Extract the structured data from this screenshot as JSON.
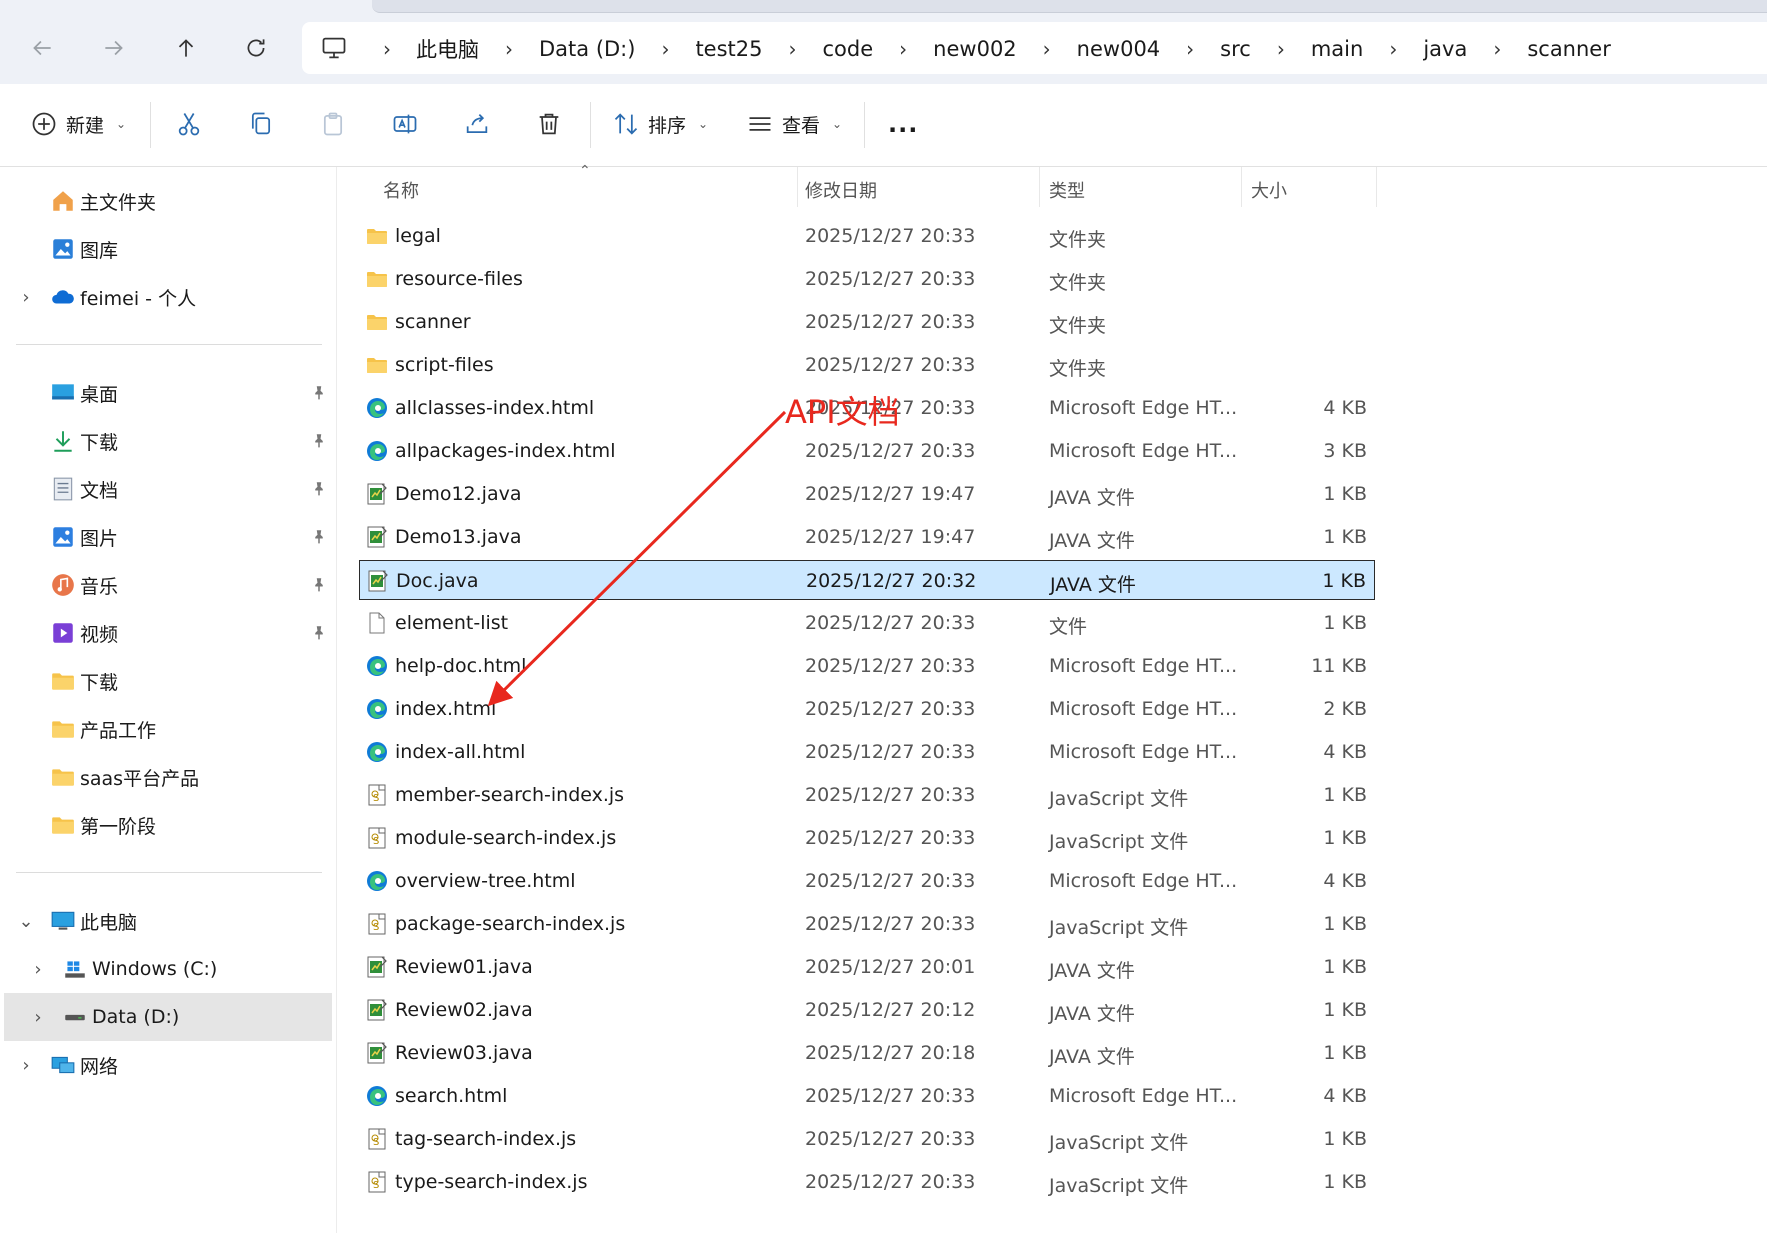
{
  "breadcrumb": [
    "此电脑",
    "Data (D:)",
    "test25",
    "code",
    "new002",
    "new004",
    "src",
    "main",
    "java",
    "scanner"
  ],
  "toolbar": {
    "new_label": "新建",
    "sort_label": "排序",
    "view_label": "查看",
    "more_label": "..."
  },
  "sidebar": {
    "quick": [
      {
        "label": "主文件夹",
        "icon": "home-icon"
      },
      {
        "label": "图库",
        "icon": "gallery-icon"
      },
      {
        "label": "feimei - 个人",
        "icon": "onedrive-cloud-icon"
      }
    ],
    "pinned": [
      {
        "label": "桌面",
        "icon": "desktop-icon",
        "pinned": true
      },
      {
        "label": "下载",
        "icon": "download-icon",
        "pinned": true
      },
      {
        "label": "文档",
        "icon": "document-icon",
        "pinned": true
      },
      {
        "label": "图片",
        "icon": "pictures-icon",
        "pinned": true
      },
      {
        "label": "音乐",
        "icon": "music-icon",
        "pinned": true
      },
      {
        "label": "视频",
        "icon": "video-icon",
        "pinned": true
      },
      {
        "label": "下载",
        "icon": "folder-icon",
        "pinned": false
      },
      {
        "label": "产品工作",
        "icon": "folder-icon",
        "pinned": false
      },
      {
        "label": "saas平台产品",
        "icon": "folder-icon",
        "pinned": false
      },
      {
        "label": "第一阶段",
        "icon": "folder-icon",
        "pinned": false
      }
    ],
    "this_pc": {
      "label": "此电脑",
      "icon": "computer-icon"
    },
    "drives": [
      {
        "label": "Windows (C:)",
        "icon": "windows-drive-icon"
      },
      {
        "label": "Data (D:)",
        "icon": "drive-icon",
        "selected": true
      }
    ],
    "network": {
      "label": "网络",
      "icon": "network-icon"
    }
  },
  "columns": {
    "name": "名称",
    "date": "修改日期",
    "type": "类型",
    "size": "大小"
  },
  "files": [
    {
      "name": "legal",
      "date": "2025/12/27 20:33",
      "type": "文件夹",
      "size": "",
      "icon": "folder-icon"
    },
    {
      "name": "resource-files",
      "date": "2025/12/27 20:33",
      "type": "文件夹",
      "size": "",
      "icon": "folder-icon"
    },
    {
      "name": "scanner",
      "date": "2025/12/27 20:33",
      "type": "文件夹",
      "size": "",
      "icon": "folder-icon"
    },
    {
      "name": "script-files",
      "date": "2025/12/27 20:33",
      "type": "文件夹",
      "size": "",
      "icon": "folder-icon"
    },
    {
      "name": "allclasses-index.html",
      "date": "2025/12/27 20:33",
      "type": "Microsoft Edge HT...",
      "size": "4 KB",
      "icon": "edge-icon"
    },
    {
      "name": "allpackages-index.html",
      "date": "2025/12/27 20:33",
      "type": "Microsoft Edge HT...",
      "size": "3 KB",
      "icon": "edge-icon"
    },
    {
      "name": "Demo12.java",
      "date": "2025/12/27 19:47",
      "type": "JAVA 文件",
      "size": "1 KB",
      "icon": "java-file-icon"
    },
    {
      "name": "Demo13.java",
      "date": "2025/12/27 19:47",
      "type": "JAVA 文件",
      "size": "1 KB",
      "icon": "java-file-icon"
    },
    {
      "name": "Doc.java",
      "date": "2025/12/27 20:32",
      "type": "JAVA 文件",
      "size": "1 KB",
      "icon": "java-file-icon",
      "selected": true
    },
    {
      "name": "element-list",
      "date": "2025/12/27 20:33",
      "type": "文件",
      "size": "1 KB",
      "icon": "blank-file-icon"
    },
    {
      "name": "help-doc.html",
      "date": "2025/12/27 20:33",
      "type": "Microsoft Edge HT...",
      "size": "11 KB",
      "icon": "edge-icon"
    },
    {
      "name": "index.html",
      "date": "2025/12/27 20:33",
      "type": "Microsoft Edge HT...",
      "size": "2 KB",
      "icon": "edge-icon"
    },
    {
      "name": "index-all.html",
      "date": "2025/12/27 20:33",
      "type": "Microsoft Edge HT...",
      "size": "4 KB",
      "icon": "edge-icon"
    },
    {
      "name": "member-search-index.js",
      "date": "2025/12/27 20:33",
      "type": "JavaScript 文件",
      "size": "1 KB",
      "icon": "js-file-icon"
    },
    {
      "name": "module-search-index.js",
      "date": "2025/12/27 20:33",
      "type": "JavaScript 文件",
      "size": "1 KB",
      "icon": "js-file-icon"
    },
    {
      "name": "overview-tree.html",
      "date": "2025/12/27 20:33",
      "type": "Microsoft Edge HT...",
      "size": "4 KB",
      "icon": "edge-icon"
    },
    {
      "name": "package-search-index.js",
      "date": "2025/12/27 20:33",
      "type": "JavaScript 文件",
      "size": "1 KB",
      "icon": "js-file-icon"
    },
    {
      "name": "Review01.java",
      "date": "2025/12/27 20:01",
      "type": "JAVA 文件",
      "size": "1 KB",
      "icon": "java-file-icon"
    },
    {
      "name": "Review02.java",
      "date": "2025/12/27 20:12",
      "type": "JAVA 文件",
      "size": "1 KB",
      "icon": "java-file-icon"
    },
    {
      "name": "Review03.java",
      "date": "2025/12/27 20:18",
      "type": "JAVA 文件",
      "size": "1 KB",
      "icon": "java-file-icon"
    },
    {
      "name": "search.html",
      "date": "2025/12/27 20:33",
      "type": "Microsoft Edge HT...",
      "size": "4 KB",
      "icon": "edge-icon"
    },
    {
      "name": "tag-search-index.js",
      "date": "2025/12/27 20:33",
      "type": "JavaScript 文件",
      "size": "1 KB",
      "icon": "js-file-icon"
    },
    {
      "name": "type-search-index.js",
      "date": "2025/12/27 20:33",
      "type": "JavaScript 文件",
      "size": "1 KB",
      "icon": "js-file-icon"
    }
  ],
  "annotation": {
    "text": "API文档",
    "color": "#e8281e"
  },
  "colors": {
    "selection_bg": "#cce8ff",
    "folder": "#f6c34a",
    "edge": "#0f7bd6",
    "sidebar_selected": "#e5e5e5"
  }
}
